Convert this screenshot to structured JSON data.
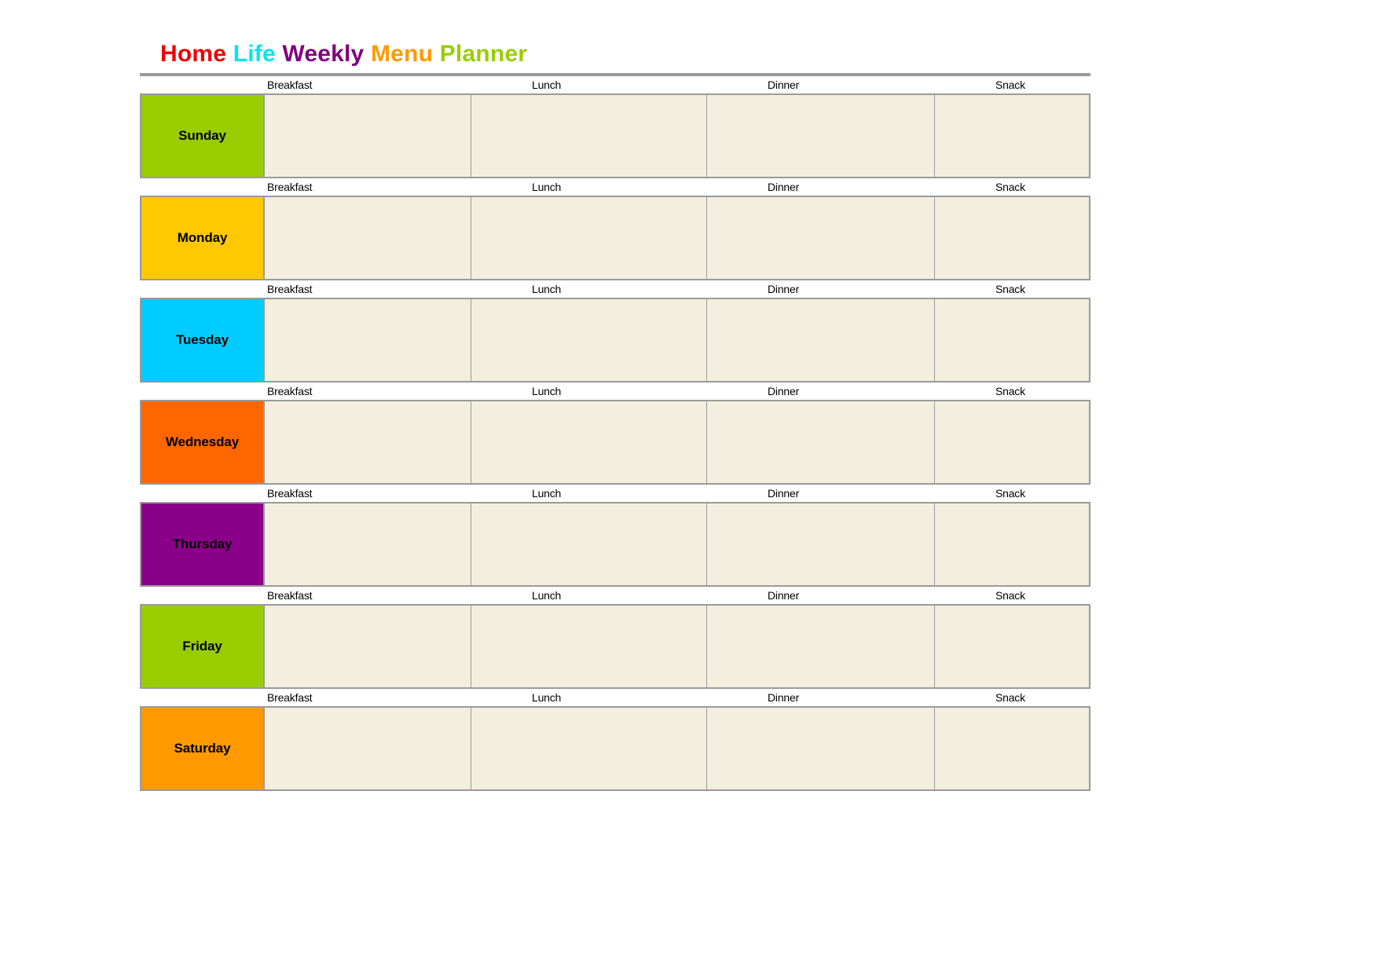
{
  "document": {
    "title_words": [
      {
        "text": "Home",
        "color": "#ee0000"
      },
      {
        "text": "Life",
        "color": "#00e5ee"
      },
      {
        "text": "Weekly",
        "color": "#800080"
      },
      {
        "text": "Menu",
        "color": "#ff9900"
      },
      {
        "text": "Planner",
        "color": "#9acd00"
      }
    ],
    "title_plain": "Home Life Weekly Menu Planner"
  },
  "meal_columns": [
    {
      "key": "breakfast",
      "label": "Breakfast"
    },
    {
      "key": "lunch",
      "label": "Lunch"
    },
    {
      "key": "dinner",
      "label": "Dinner"
    },
    {
      "key": "snack",
      "label": "Snack"
    }
  ],
  "days": [
    {
      "name": "Sunday",
      "color": "#9acd00",
      "meals": {
        "breakfast": "",
        "lunch": "",
        "dinner": "",
        "snack": ""
      }
    },
    {
      "name": "Monday",
      "color": "#ffc800",
      "meals": {
        "breakfast": "",
        "lunch": "",
        "dinner": "",
        "snack": ""
      }
    },
    {
      "name": "Tuesday",
      "color": "#00ccff",
      "meals": {
        "breakfast": "",
        "lunch": "",
        "dinner": "",
        "snack": ""
      }
    },
    {
      "name": "Wednesday",
      "color": "#ff6600",
      "meals": {
        "breakfast": "",
        "lunch": "",
        "dinner": "",
        "snack": ""
      }
    },
    {
      "name": "Thursday",
      "color": "#8b0088",
      "meals": {
        "breakfast": "",
        "lunch": "",
        "dinner": "",
        "snack": ""
      }
    },
    {
      "name": "Friday",
      "color": "#9acd00",
      "meals": {
        "breakfast": "",
        "lunch": "",
        "dinner": "",
        "snack": ""
      }
    },
    {
      "name": "Saturday",
      "color": "#ff9900",
      "meals": {
        "breakfast": "",
        "lunch": "",
        "dinner": "",
        "snack": ""
      }
    }
  ],
  "style": {
    "cell_fill": "#f3eede",
    "border_color": "#9a9a9a",
    "page_background": "#ffffff",
    "rule_color": "#9a9a9a"
  }
}
